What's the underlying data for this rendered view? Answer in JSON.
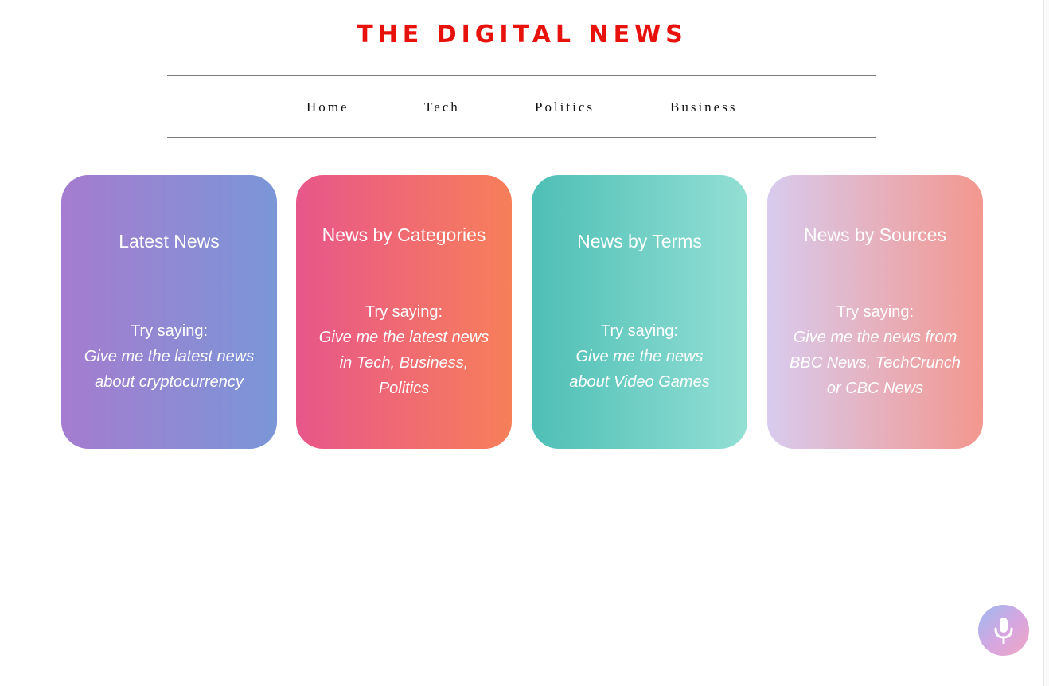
{
  "header": {
    "title": "THE DIGITAL NEWS"
  },
  "nav": {
    "items": [
      {
        "label": "Home"
      },
      {
        "label": "Tech"
      },
      {
        "label": "Politics"
      },
      {
        "label": "Business"
      }
    ]
  },
  "cards": [
    {
      "title": "Latest News",
      "prompt_label": "Try saying:",
      "example_lines": [
        "Give me the latest news",
        "about cryptocurrency"
      ],
      "gradient": [
        "#a57ccf",
        "#7b96d7"
      ]
    },
    {
      "title": "News by Categories",
      "prompt_label": "Try saying:",
      "example_lines": [
        "Give me the latest news",
        "in Tech, Business,",
        "Politics"
      ],
      "gradient": [
        "#e8568a",
        "#f77f5a"
      ]
    },
    {
      "title": "News by Terms",
      "prompt_label": "Try saying:",
      "example_lines": [
        "Give me the news",
        "about Video Games"
      ],
      "gradient": [
        "#4ebfb6",
        "#93dfd4"
      ]
    },
    {
      "title": "News by Sources",
      "prompt_label": "Try saying:",
      "example_lines": [
        "Give me the news from",
        "BBC News, TechCrunch",
        "or CBC News"
      ],
      "gradient": [
        "#d8cbee",
        "#f3978f"
      ]
    }
  ],
  "voice_button": {
    "icon": "microphone-icon"
  },
  "colors": {
    "brand": "#e8120c",
    "nav_text": "#111111",
    "card_text": "#ffffff"
  }
}
